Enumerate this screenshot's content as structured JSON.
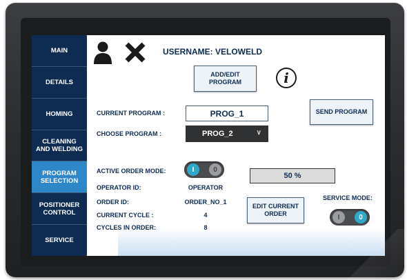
{
  "sidebar": {
    "items": [
      {
        "label": "MAIN"
      },
      {
        "label": "DETAILS"
      },
      {
        "label": "HOMING"
      },
      {
        "label": "CLEANING AND WELDING"
      },
      {
        "label": "PROGRAM SELECTION",
        "active": true
      },
      {
        "label": "POSITIONER CONTROL"
      },
      {
        "label": "SERVICE"
      }
    ]
  },
  "header": {
    "user_icon": "user-icon",
    "close_icon": "close-icon",
    "username_label": "USERNAME: VELOWELD"
  },
  "buttons": {
    "add_edit": "ADD/EDIT PROGRAM",
    "send": "SEND PROGRAM",
    "edit_order": "EDIT CURRENT ORDER"
  },
  "info_icon": {
    "glyph": "i",
    "icon": "info-icon"
  },
  "program": {
    "current_label": "CURRENT PROGRAM :",
    "current_value": "PROG_1",
    "choose_label": "CHOOSE PROGRAM :",
    "choose_value": "PROG_2"
  },
  "order": {
    "active_mode_label": "ACTIVE ORDER MODE:",
    "active_mode_on": "I",
    "active_mode_off": "0",
    "operator_label": "OPERATOR ID:",
    "operator_value": "OPERATOR",
    "order_label": "ORDER ID:",
    "order_value": "ORDER_NO_1",
    "cycle_label": "CURRENT CYCLE :",
    "cycle_value": "4",
    "cycles_label": "CYCLES IN ORDER:",
    "cycles_value": "8",
    "progress_text": "50 %",
    "progress_value": 0.5
  },
  "service": {
    "label": "SERVICE MODE:",
    "off": "I",
    "on": "0"
  },
  "colors": {
    "sidebar_bg": "#0e2c52",
    "active_nav": "#2d87c8",
    "toggle_on": "#2ea9c9"
  }
}
